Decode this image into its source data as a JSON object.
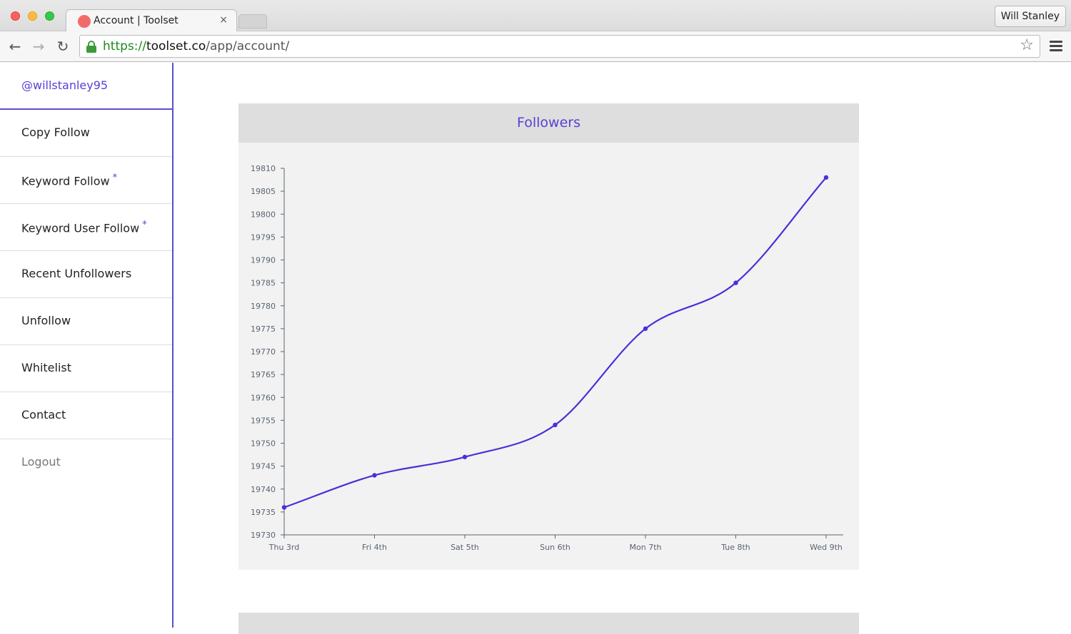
{
  "browser": {
    "tab_title": "Account | Toolset",
    "tab_close": "×",
    "profile_name": "Will Stanley",
    "url_scheme": "https://",
    "url_host": "toolset.co",
    "url_path": "/app/account/",
    "back_icon": "←",
    "forward_icon": "→",
    "reload_icon": "↻",
    "star_icon": "☆"
  },
  "sidebar": {
    "username": "@willstanley95",
    "items": [
      {
        "label": "Copy Follow",
        "starred": false
      },
      {
        "label": "Keyword Follow",
        "starred": true
      },
      {
        "label": "Keyword User Follow",
        "starred": true
      },
      {
        "label": "Recent Unfollowers",
        "starred": false
      },
      {
        "label": "Unfollow",
        "starred": false
      },
      {
        "label": "Whitelist",
        "starred": false
      },
      {
        "label": "Contact",
        "starred": false
      }
    ],
    "star_marker": "*",
    "logout_label": "Logout"
  },
  "colors": {
    "accent": "#5a3fd6",
    "line": "#4b2fd8"
  },
  "chart_data": {
    "type": "line",
    "title": "Followers",
    "categories": [
      "Thu 3rd",
      "Fri 4th",
      "Sat 5th",
      "Sun 6th",
      "Mon 7th",
      "Tue 8th",
      "Wed 9th"
    ],
    "series": [
      {
        "values": [
          19736,
          19743,
          19747,
          19754,
          19775,
          19785,
          19808
        ]
      }
    ],
    "ylim": [
      19730,
      19810
    ],
    "yticks": [
      19730,
      19735,
      19740,
      19745,
      19750,
      19755,
      19760,
      19765,
      19770,
      19775,
      19780,
      19785,
      19790,
      19795,
      19800,
      19805,
      19810
    ],
    "xlabel": "",
    "ylabel": "",
    "grid": false
  }
}
